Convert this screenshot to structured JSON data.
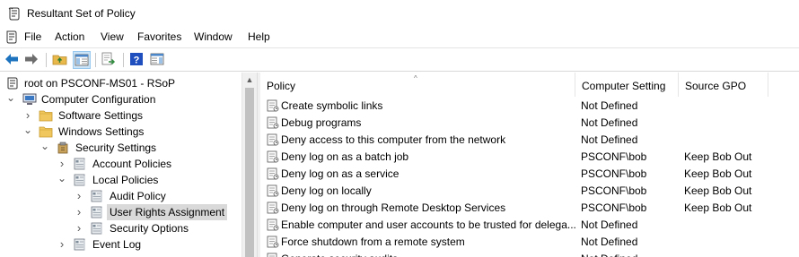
{
  "window": {
    "title": "Resultant Set of Policy"
  },
  "menu": [
    "File",
    "Action",
    "View",
    "Favorites",
    "Window",
    "Help"
  ],
  "tree": [
    {
      "label": "root on PSCONF-MS01 - RSoP",
      "expander": "",
      "icon": "rsop-root-icon"
    },
    {
      "label": "Computer Configuration",
      "expander": "expanded",
      "icon": "computer-icon"
    },
    {
      "label": "Software Settings",
      "expander": "collapsed",
      "icon": "folder-icon"
    },
    {
      "label": "Windows Settings",
      "expander": "expanded",
      "icon": "folder-icon"
    },
    {
      "label": "Security Settings",
      "expander": "expanded",
      "icon": "security-settings-icon"
    },
    {
      "label": "Account Policies",
      "expander": "collapsed",
      "icon": "policy-book-icon"
    },
    {
      "label": "Local Policies",
      "expander": "expanded",
      "icon": "policy-book-icon"
    },
    {
      "label": "Audit Policy",
      "expander": "collapsed",
      "icon": "policy-book-icon"
    },
    {
      "label": "User Rights Assignment",
      "expander": "collapsed",
      "icon": "policy-book-icon",
      "selected": true
    },
    {
      "label": "Security Options",
      "expander": "collapsed",
      "icon": "policy-book-icon"
    },
    {
      "label": "Event Log",
      "expander": "collapsed",
      "icon": "policy-book-icon"
    }
  ],
  "columns": {
    "policy": "Policy",
    "computer_setting": "Computer Setting",
    "source_gpo": "Source GPO"
  },
  "rows": [
    {
      "policy": "Create symbolic links",
      "setting": "Not Defined",
      "gpo": ""
    },
    {
      "policy": "Debug programs",
      "setting": "Not Defined",
      "gpo": ""
    },
    {
      "policy": "Deny access to this computer from the network",
      "setting": "Not Defined",
      "gpo": ""
    },
    {
      "policy": "Deny log on as a batch job",
      "setting": "PSCONF\\bob",
      "gpo": "Keep Bob Out"
    },
    {
      "policy": "Deny log on as a service",
      "setting": "PSCONF\\bob",
      "gpo": "Keep Bob Out"
    },
    {
      "policy": "Deny log on locally",
      "setting": "PSCONF\\bob",
      "gpo": "Keep Bob Out"
    },
    {
      "policy": "Deny log on through Remote Desktop Services",
      "setting": "PSCONF\\bob",
      "gpo": "Keep Bob Out"
    },
    {
      "policy": "Enable computer and user accounts to be trusted for delega...",
      "setting": "Not Defined",
      "gpo": ""
    },
    {
      "policy": "Force shutdown from a remote system",
      "setting": "Not Defined",
      "gpo": ""
    },
    {
      "policy": "Generate security audits",
      "setting": "Not Defined",
      "gpo": ""
    }
  ],
  "colors": {
    "selection": "#d9d9d9",
    "toolbar_pressed": "#cce4f7",
    "nav_arrow": "#1e73be"
  }
}
